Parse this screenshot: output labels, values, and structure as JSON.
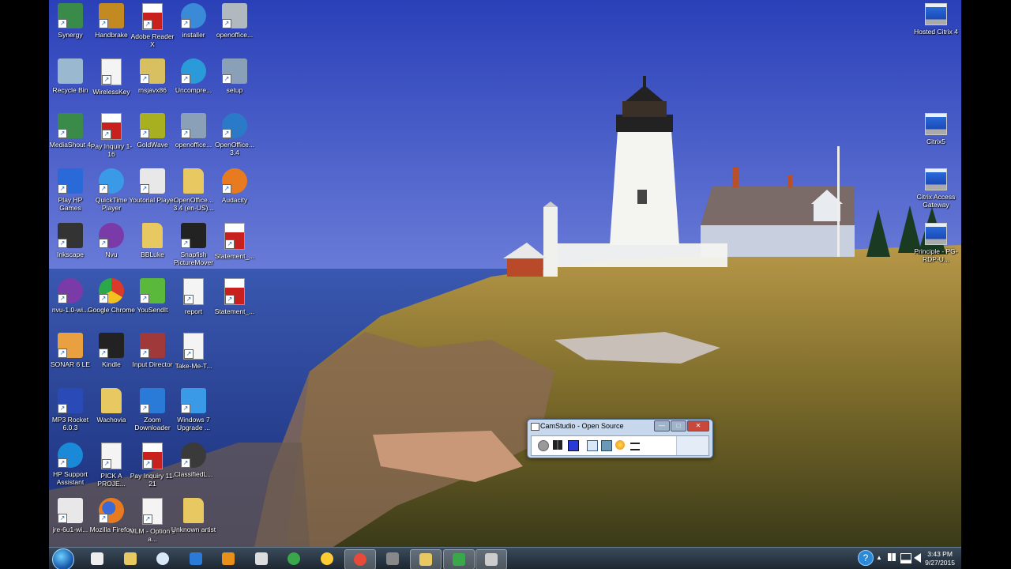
{
  "desktop": {
    "icons": [
      {
        "label": "Synergy",
        "col": 0,
        "row": 0,
        "icon": "synergy-icon",
        "color": "#3a8a4a"
      },
      {
        "label": "Handbrake",
        "col": 1,
        "row": 0,
        "icon": "pineapple-icon",
        "color": "#c48a22"
      },
      {
        "label": "Adobe Reader X",
        "col": 2,
        "row": 0,
        "icon": "pdf-icon",
        "color": "#c8201c"
      },
      {
        "label": "installer",
        "col": 3,
        "row": 0,
        "icon": "installer-icon",
        "color": "#3a8ad8"
      },
      {
        "label": "openoffice...",
        "col": 4,
        "row": 0,
        "icon": "package-icon",
        "color": "#b0b8c0"
      },
      {
        "label": "Recycle Bin",
        "col": 0,
        "row": 1,
        "icon": "recycle-bin-icon",
        "color": "#9ab8d0"
      },
      {
        "label": "WirelessKey",
        "col": 1,
        "row": 1,
        "icon": "document-icon",
        "color": "#e8e8e8"
      },
      {
        "label": "msjavx86",
        "col": 2,
        "row": 1,
        "icon": "installer-box-icon",
        "color": "#d8c060"
      },
      {
        "label": "Uncompre...",
        "col": 3,
        "row": 1,
        "icon": "lock-globe-icon",
        "color": "#2a9ad8"
      },
      {
        "label": "setup",
        "col": 4,
        "row": 1,
        "icon": "setup-icon",
        "color": "#8aa0b8"
      },
      {
        "label": "MediaShout 4",
        "col": 0,
        "row": 2,
        "icon": "mediashout-icon",
        "color": "#3a8a4a"
      },
      {
        "label": "Pay Inquiry 1-16",
        "col": 1,
        "row": 2,
        "icon": "pdf-icon",
        "color": "#c8201c"
      },
      {
        "label": "GoldWave",
        "col": 2,
        "row": 2,
        "icon": "goldwave-icon",
        "color": "#a8b020"
      },
      {
        "label": "openoffice...",
        "col": 3,
        "row": 2,
        "icon": "setup-icon",
        "color": "#8aa0b8"
      },
      {
        "label": "OpenOffice... 3.4",
        "col": 4,
        "row": 2,
        "icon": "openoffice-icon",
        "color": "#2a7ac8"
      },
      {
        "label": "Play HP Games",
        "col": 0,
        "row": 3,
        "icon": "hp-games-icon",
        "color": "#2a6ad8"
      },
      {
        "label": "QuickTime Player",
        "col": 1,
        "row": 3,
        "icon": "quicktime-icon",
        "color": "#3a9ae8"
      },
      {
        "label": "Youtorial Player",
        "col": 2,
        "row": 3,
        "icon": "chess-icon",
        "color": "#e8e8e8"
      },
      {
        "label": "OpenOffice... 3.4 (en-US)...",
        "col": 3,
        "row": 3,
        "icon": "folder-icon",
        "color": "#e8c860"
      },
      {
        "label": "Audacity",
        "col": 4,
        "row": 3,
        "icon": "audacity-icon",
        "color": "#e87a20"
      },
      {
        "label": "Inkscape",
        "col": 0,
        "row": 4,
        "icon": "inkscape-icon",
        "color": "#333333"
      },
      {
        "label": "Nvu",
        "col": 1,
        "row": 4,
        "icon": "nvu-icon",
        "color": "#7a3aa8"
      },
      {
        "label": "BBLuke",
        "col": 2,
        "row": 4,
        "icon": "folder-icon",
        "color": "#e8c860"
      },
      {
        "label": "Snapfish PictureMover",
        "col": 3,
        "row": 4,
        "icon": "fish-icon",
        "color": "#222222"
      },
      {
        "label": "Statement_...",
        "col": 4,
        "row": 4,
        "icon": "pdf-icon",
        "color": "#c8201c"
      },
      {
        "label": "nvu-1.0-wi...",
        "col": 0,
        "row": 5,
        "icon": "nvu-icon",
        "color": "#7a3aa8"
      },
      {
        "label": "Google Chrome",
        "col": 1,
        "row": 5,
        "icon": "chrome-icon",
        "color": "#e84a3a"
      },
      {
        "label": "YouSendIt",
        "col": 2,
        "row": 5,
        "icon": "paper-plane-icon",
        "color": "#5ab83a"
      },
      {
        "label": "report",
        "col": 3,
        "row": 5,
        "icon": "document-icon",
        "color": "#e8e8e8"
      },
      {
        "label": "Statement_...",
        "col": 4,
        "row": 5,
        "icon": "pdf-icon",
        "color": "#c8201c"
      },
      {
        "label": "SONAR 6 LE",
        "col": 0,
        "row": 6,
        "icon": "sonar-icon",
        "color": "#e8a040"
      },
      {
        "label": "Kindle",
        "col": 1,
        "row": 6,
        "icon": "kindle-icon",
        "color": "#222222"
      },
      {
        "label": "Input Director",
        "col": 2,
        "row": 6,
        "icon": "input-director-icon",
        "color": "#a03a3a"
      },
      {
        "label": "Take-Me-T...",
        "col": 3,
        "row": 6,
        "icon": "mp3-icon",
        "color": "#e8e8e8"
      },
      {
        "label": "MP3 Rocket 6.0.3",
        "col": 0,
        "row": 7,
        "icon": "rocket-icon",
        "color": "#2a4ab8"
      },
      {
        "label": "Wachovia",
        "col": 1,
        "row": 7,
        "icon": "folder-icon",
        "color": "#e8c860"
      },
      {
        "label": "Zoom Downloader",
        "col": 2,
        "row": 7,
        "icon": "zoom-downloader-icon",
        "color": "#2a7ad8"
      },
      {
        "label": "Windows 7 Upgrade ...",
        "col": 3,
        "row": 7,
        "icon": "windows-upgrade-icon",
        "color": "#3a9ae8"
      },
      {
        "label": "HP Support Assistant",
        "col": 0,
        "row": 8,
        "icon": "help-icon",
        "color": "#1a8ad8"
      },
      {
        "label": "PICK A PROJE...",
        "col": 1,
        "row": 8,
        "icon": "document-icon",
        "color": "#e8e8e8"
      },
      {
        "label": "Pay Inquiry 11-21",
        "col": 2,
        "row": 8,
        "icon": "pdf-icon",
        "color": "#c8201c"
      },
      {
        "label": "ClassifiedL...",
        "col": 3,
        "row": 8,
        "icon": "classified-icon",
        "color": "#3a3a3a"
      },
      {
        "label": "jre-6u1-wi...",
        "col": 0,
        "row": 9,
        "icon": "java-icon",
        "color": "#e8e8e8"
      },
      {
        "label": "Mozilla Firefox",
        "col": 1,
        "row": 9,
        "icon": "firefox-icon",
        "color": "#e87a20"
      },
      {
        "label": "MLM - Option 1 a...",
        "col": 2,
        "row": 9,
        "icon": "mp3-icon",
        "color": "#e8e8e8"
      },
      {
        "label": "Unknown artist",
        "col": 3,
        "row": 9,
        "icon": "folder-icon",
        "color": "#e8c860"
      }
    ],
    "right_icons": [
      {
        "label": "Hosted Citrix 4",
        "row": 0
      },
      {
        "label": "Citrix5",
        "row": 2
      },
      {
        "label": "Citrix Access Gateway",
        "row": 3
      },
      {
        "label": "Principle - PG-RDP-U...",
        "row": 4
      }
    ]
  },
  "camstudio": {
    "title": "CamStudio - Open Source",
    "min": "—",
    "max": "□",
    "close": "✕",
    "tools": [
      "record-icon",
      "pause-icon",
      "stop-icon",
      "region-icon",
      "annotate-icon",
      "settings-icon",
      "swap-icon"
    ]
  },
  "taskbar": {
    "time": "3:43 PM",
    "date": "9/27/2015",
    "apps": [
      "inkscape-icon",
      "explorer-icon",
      "hp-icon",
      "tasks-icon",
      "media-player-icon",
      "amazon-icon",
      "hp-games-icon",
      "sun-icon",
      "chrome-icon",
      "media-icon",
      "explorer-icon",
      "camstudio-icon",
      "video-icon"
    ],
    "active": [
      8,
      10,
      11,
      12
    ]
  }
}
